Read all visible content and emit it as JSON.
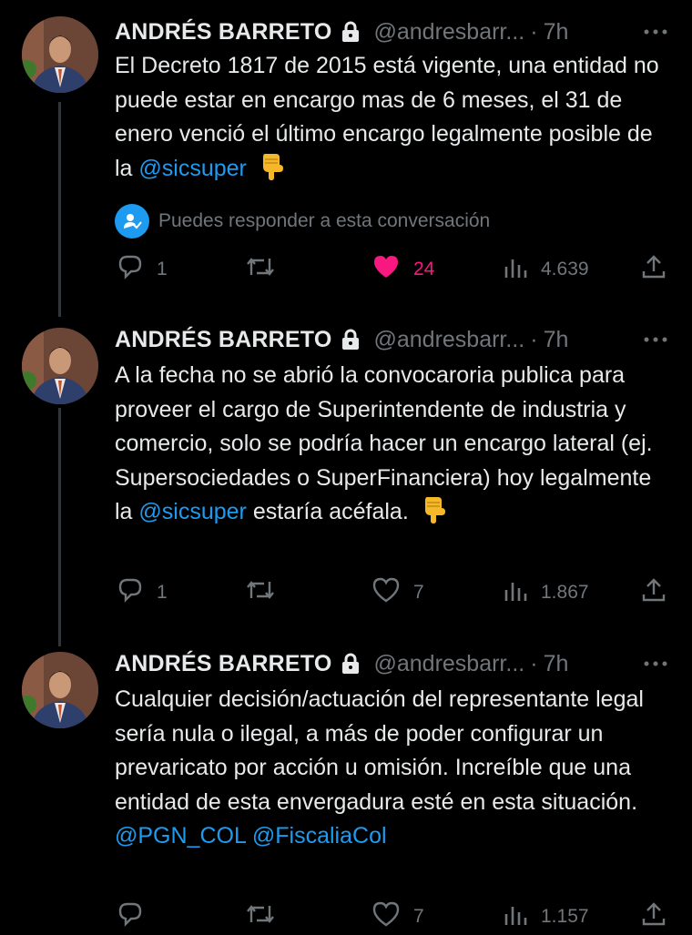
{
  "tweets": [
    {
      "name": "ANDRÉS BARRETO",
      "handle": "@andresbarr...",
      "separator": "·",
      "time": "7h",
      "text_before": "El Decreto 1817 de 2015 está vigente, una entidad no puede estar en encargo mas de 6 meses, el 31 de enero venció el último encargo legalmente posible de la ",
      "mention": "@sicsuper",
      "text_after": "",
      "reply_note": "Puedes responder a esta conversación",
      "replies": "1",
      "retweets": "",
      "likes": "24",
      "liked": true,
      "views": "4.639"
    },
    {
      "name": "ANDRÉS BARRETO",
      "handle": "@andresbarr...",
      "separator": "·",
      "time": "7h",
      "text_before": "A la fecha no se abrió la convocaroria publica para proveer el cargo de Superintendente de industria y comercio, solo se podría hacer un encargo lateral (ej. Supersociedades o SuperFinanciera) hoy legalmente la ",
      "mention": "@sicsuper",
      "text_after": " estaría acéfala.",
      "replies": "1",
      "retweets": "",
      "likes": "7",
      "liked": false,
      "views": "1.867"
    },
    {
      "name": "ANDRÉS BARRETO",
      "handle": "@andresbarr...",
      "separator": "·",
      "time": "7h",
      "text_before": "Cualquier decisión/actuación del representante legal sería nula o ilegal, a más de poder configurar un prevaricato por acción u omisión. Increíble que una entidad de esta envergadura esté en esta situación.",
      "mention1": "@PGN_COL",
      "mention2": "@FiscaliaCol",
      "replies": "",
      "retweets": "",
      "likes": "7",
      "liked": false,
      "views": "1.157"
    }
  ],
  "icons": {
    "lock": "lock-icon",
    "more": "more-icon",
    "reply": "reply-icon",
    "retweet": "retweet-icon",
    "like": "heart-icon",
    "views": "views-icon",
    "share": "share-icon",
    "emoji": "backhand-index-pointing-down-emoji"
  },
  "colors": {
    "background": "#000000",
    "text": "#e7e9ea",
    "muted": "#71767b",
    "link": "#1d9bf0",
    "like": "#f91880"
  }
}
